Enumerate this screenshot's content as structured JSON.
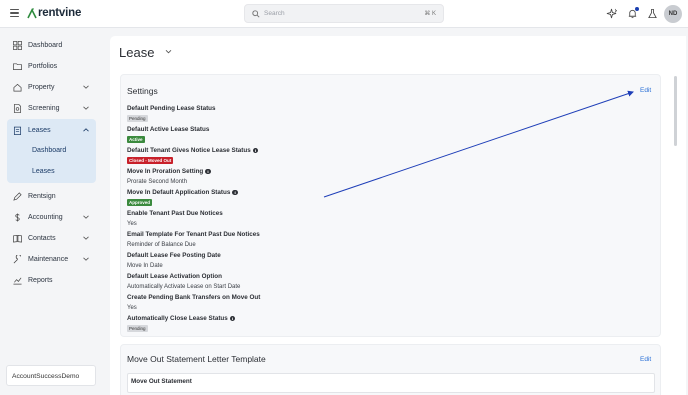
{
  "app": {
    "brand": "rentvine"
  },
  "search": {
    "placeholder": "Search",
    "shortcut": "⌘ K"
  },
  "user": {
    "initials": "ND"
  },
  "sidebar": {
    "items": [
      {
        "label": "Dashboard",
        "icon": "grid-icon"
      },
      {
        "label": "Portfolios",
        "icon": "folder-icon"
      },
      {
        "label": "Property",
        "icon": "home-icon"
      },
      {
        "label": "Screening",
        "icon": "document-search-icon"
      },
      {
        "label": "Leases",
        "icon": "clipboard-icon"
      },
      {
        "label": "Rentsign",
        "icon": "pen-icon"
      },
      {
        "label": "Accounting",
        "icon": "dollar-icon"
      },
      {
        "label": "Contacts",
        "icon": "address-book-icon"
      },
      {
        "label": "Maintenance",
        "icon": "wrench-icon"
      },
      {
        "label": "Reports",
        "icon": "chart-icon"
      }
    ],
    "leases_sub": [
      "Dashboard",
      "Leases"
    ],
    "account": "AccountSuccessDemo"
  },
  "page": {
    "title": "Lease"
  },
  "settings_card": {
    "title": "Settings",
    "edit": "Edit",
    "items": [
      {
        "label": "Default Pending Lease Status",
        "badge": "Pending"
      },
      {
        "label": "Default Active Lease Status",
        "badge": "Active"
      },
      {
        "label": "Default Tenant Gives Notice Lease Status",
        "badge": "Closed - Moved Out"
      },
      {
        "label": "Move In Proration Setting",
        "value": "Prorate Second Month"
      },
      {
        "label": "Move In Default Application Status",
        "badge": "Approved"
      },
      {
        "label": "Enable Tenant Past Due Notices",
        "value": "Yes"
      },
      {
        "label": "Email Template For Tenant Past Due Notices",
        "value": "Reminder of Balance Due"
      },
      {
        "label": "Default Lease Fee Posting Date",
        "value": "Move In Date"
      },
      {
        "label": "Default Lease Activation Option",
        "value": "Automatically Activate Lease on Start Date"
      },
      {
        "label": "Create Pending Bank Transfers on Move Out",
        "value": "Yes"
      },
      {
        "label": "Automatically Close Lease Status",
        "badge": "Pending"
      }
    ]
  },
  "moveout_card": {
    "title": "Move Out Statement Letter Template",
    "edit": "Edit",
    "inner_label": "Move Out Statement"
  },
  "colors": {
    "accent": "#2a6fd6",
    "arrow": "#1f3fb8",
    "active_nav": "#dde9f5"
  }
}
